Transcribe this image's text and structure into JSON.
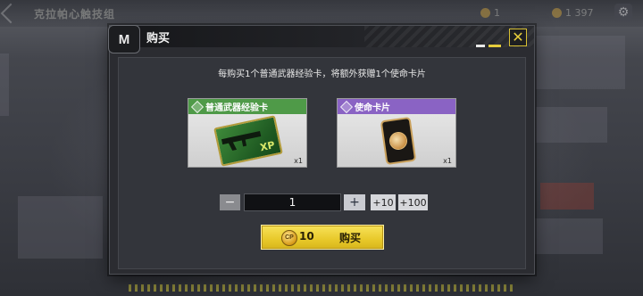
{
  "background": {
    "title": "克拉帕心触技组",
    "currency_left": "1",
    "currency_right": "1 397"
  },
  "dialog": {
    "title": "购买",
    "emblem_label": "M",
    "close_label": "✕",
    "info_text": "每购买1个普通武器经验卡，将额外获赠1个使命卡片",
    "items": [
      {
        "name": "普通武器经验卡",
        "count": "x1",
        "header_color": "#4f9a48",
        "icon": "weapon-xp-card-icon",
        "badge": "XP"
      },
      {
        "name": "使命卡片",
        "count": "x1",
        "header_color": "#8a63c4",
        "icon": "mission-card-icon"
      }
    ],
    "quantity": {
      "minus_label": "−",
      "value": "1",
      "plus_label": "+",
      "add_10_label": "+10",
      "add_100_label": "+100"
    },
    "buy": {
      "currency_icon": "cp-coin-icon",
      "currency_symbol": "CP",
      "price": "10",
      "label": "购买"
    }
  },
  "colors": {
    "accent_yellow": "#e8c92a",
    "panel_bg": "#33353b"
  }
}
